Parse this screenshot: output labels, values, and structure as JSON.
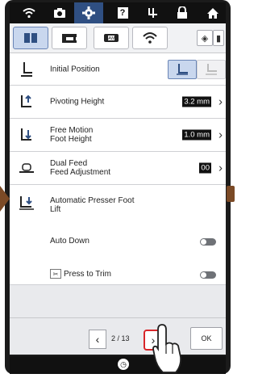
{
  "top_tabs": [
    {
      "icon": "wifi-icon",
      "glyph": "◠"
    },
    {
      "icon": "camera-icon",
      "glyph": "▣"
    },
    {
      "icon": "gear-icon",
      "glyph": "⚙",
      "active": true
    },
    {
      "icon": "help-icon",
      "glyph": "?"
    },
    {
      "icon": "presser-foot-icon",
      "glyph": "Ψ"
    },
    {
      "icon": "lock-icon",
      "glyph": "■"
    },
    {
      "icon": "home-icon",
      "glyph": "⌂"
    }
  ],
  "settings": {
    "initial_position": {
      "label": "Initial Position"
    },
    "pivoting_height": {
      "label": "Pivoting Height",
      "value": "3.2 mm"
    },
    "free_motion_foot_height": {
      "label_line1": "Free Motion",
      "label_line2": "Foot Height",
      "value": "1.0 mm"
    },
    "dual_feed_adjustment": {
      "label_line1": "Dual Feed",
      "label_line2": "Feed Adjustment",
      "value": "00"
    },
    "automatic_presser_foot_lift": {
      "label_line1": "Automatic Presser Foot",
      "label_line2": "Lift"
    },
    "auto_down": {
      "label": "Auto Down",
      "enabled": false
    },
    "press_to_trim": {
      "icon": "scissors-icon",
      "label": "Press to Trim",
      "enabled": false
    }
  },
  "pagination": {
    "current": "2 / 13",
    "ok_label": "OK"
  },
  "colors": {
    "active_tab": "#2f4f82",
    "subtab_active": "#c9d7ee"
  }
}
